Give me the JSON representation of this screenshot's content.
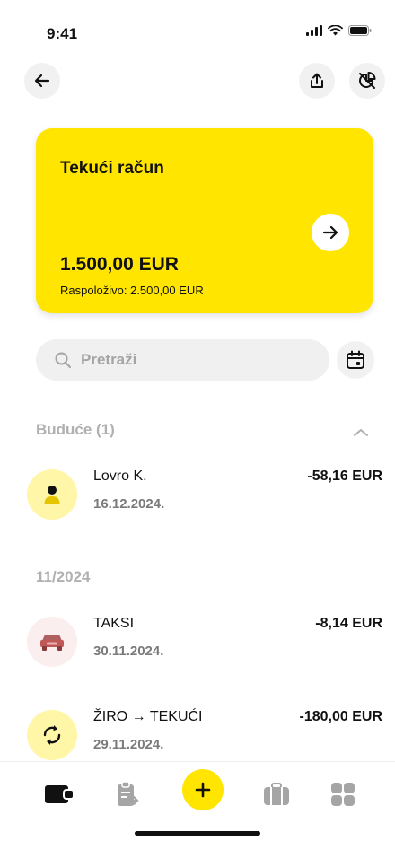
{
  "status": {
    "time": "9:41"
  },
  "account": {
    "title": "Tekući račun",
    "balance": "1.500,00 EUR",
    "available": "Raspoloživo: 2.500,00 EUR"
  },
  "search": {
    "placeholder": "Pretraži",
    "value": ""
  },
  "sections": {
    "upcoming": "Buduće (1)",
    "month": "11/2024"
  },
  "transactions": [
    {
      "name": "Lovro K.",
      "date": "16.12.2024.",
      "amount": "-58,16 EUR",
      "icon": "person-icon"
    },
    {
      "name": "TAKSI",
      "date": "30.11.2024.",
      "amount": "-8,14 EUR",
      "icon": "car-icon"
    },
    {
      "name": "ŽIRO → TEKUĆI",
      "date": "29.11.2024.",
      "amount": "-180,00 EUR",
      "icon": "transfer-icon"
    }
  ],
  "colors": {
    "accent": "#ffe500",
    "upcomingIconBg": "#fff6a8",
    "taxiIconBg": "#fbeeee",
    "muted": "#b0b0b0"
  }
}
